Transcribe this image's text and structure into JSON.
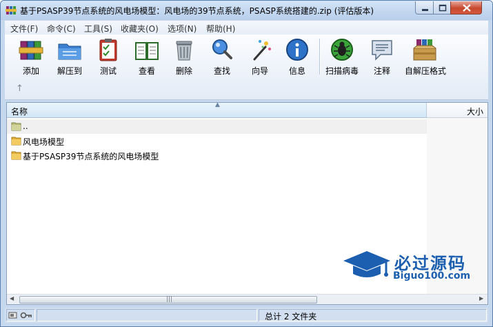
{
  "window": {
    "title": "基于PSASP39节点系统的风电场模型：风电场的39节点系统，PSASP系统搭建的.zip (评估版本)"
  },
  "menu": [
    {
      "label": "文件(F)"
    },
    {
      "label": "命令(C)"
    },
    {
      "label": "工具(S)"
    },
    {
      "label": "收藏夹(O)"
    },
    {
      "label": "选项(N)"
    },
    {
      "label": "帮助(H)"
    }
  ],
  "toolbar": [
    {
      "label": "添加",
      "icon": "add-books-icon"
    },
    {
      "label": "解压到",
      "icon": "extract-folder-icon"
    },
    {
      "label": "测试",
      "icon": "test-clipboard-icon"
    },
    {
      "label": "查看",
      "icon": "view-book-icon"
    },
    {
      "label": "删除",
      "icon": "trash-icon"
    },
    {
      "label": "查找",
      "icon": "magnifier-icon"
    },
    {
      "label": "向导",
      "icon": "wizard-wand-icon"
    },
    {
      "label": "信息",
      "icon": "info-icon"
    },
    {
      "label": "扫描病毒",
      "icon": "virus-scan-icon"
    },
    {
      "label": "注释",
      "icon": "comment-icon"
    },
    {
      "label": "自解压格式",
      "icon": "sfx-box-icon"
    }
  ],
  "columns": {
    "name": "名称",
    "size": "大小"
  },
  "files": [
    {
      "name": "..",
      "type": "parent"
    },
    {
      "name": "风电场模型",
      "type": "folder"
    },
    {
      "name": "基于PSASP39节点系统的风电场模型",
      "type": "folder"
    }
  ],
  "watermark": {
    "text": "必过源码",
    "url": "Biguo100.com"
  },
  "status": {
    "text": "总计 2 文件夹"
  },
  "colors": {
    "accent": "#1c5fb0",
    "frame": "#c6d8ee"
  }
}
